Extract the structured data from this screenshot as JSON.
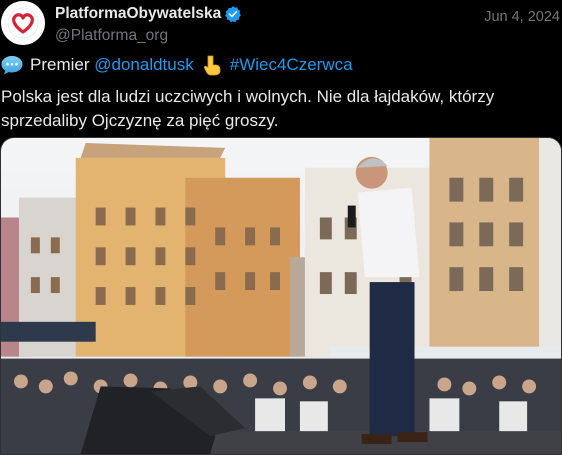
{
  "account": {
    "display_name": "PlatformaObywatelska",
    "handle": "@Platforma_org",
    "date": "Jun 4, 2024",
    "avatar_icon": "heart-logo-icon",
    "verified_icon": "verified-badge-icon",
    "accent_color": "#1d9bf0"
  },
  "tweet": {
    "prefix": "Premier",
    "mention": "@donaldtusk",
    "hashtag": "#Wiec4Czerwca",
    "body": "Polska jest dla ludzi uczciwych i wolnych. Nie dla łajdaków, którzy sprzedaliby Ojczyznę za pięć groszy."
  },
  "media": {
    "description_icon": "rally-photo"
  }
}
